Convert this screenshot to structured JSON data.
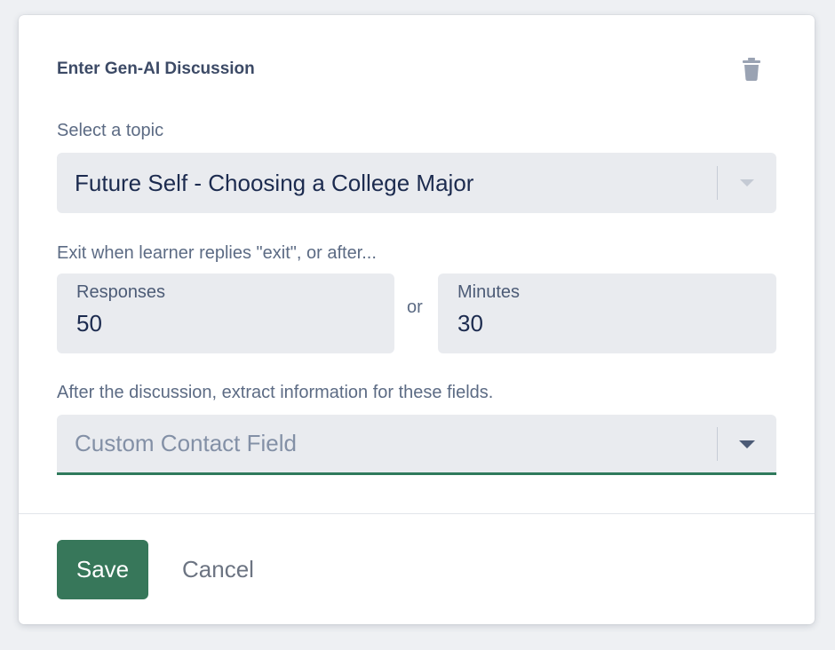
{
  "card": {
    "title": "Enter Gen-AI Discussion",
    "delete_icon": "trash-icon"
  },
  "topic": {
    "label": "Select a topic",
    "value": "Future Self - Choosing a College Major",
    "caret_icon": "chevron-down-icon"
  },
  "exit": {
    "label": "Exit when learner replies \"exit\", or after...",
    "responses_label": "Responses",
    "responses_value": "50",
    "or_text": "or",
    "minutes_label": "Minutes",
    "minutes_value": "30"
  },
  "extract": {
    "label": "After the discussion, extract information for these fields.",
    "placeholder": "Custom Contact Field",
    "caret_icon": "chevron-down-icon"
  },
  "footer": {
    "save_label": "Save",
    "cancel_label": "Cancel"
  },
  "colors": {
    "primary": "#37775a",
    "focus_underline": "#2f7a5c",
    "field_bg": "#e9ebef",
    "text_dark": "#1c2b4f"
  }
}
